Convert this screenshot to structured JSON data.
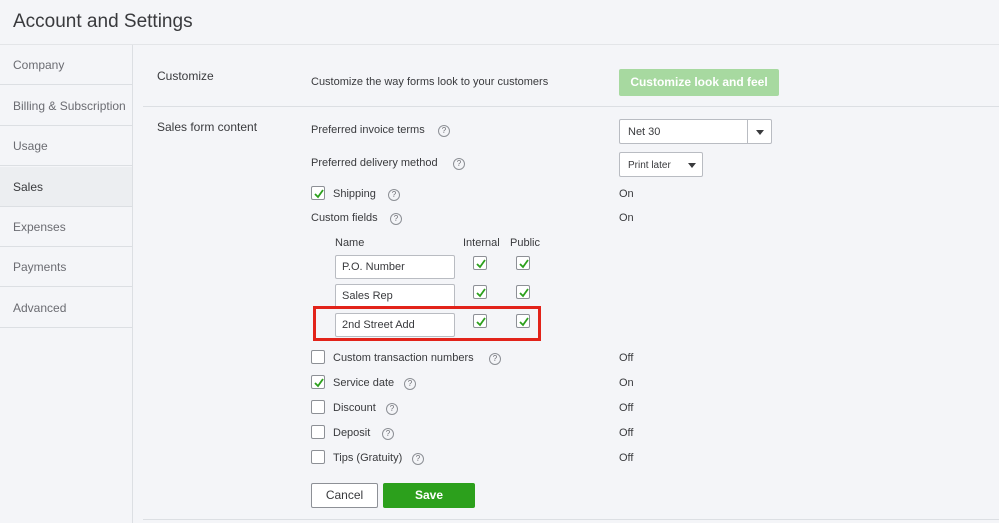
{
  "header": {
    "title": "Account and Settings"
  },
  "sidebar": {
    "items": [
      {
        "label": "Company"
      },
      {
        "label": "Billing & Subscription"
      },
      {
        "label": "Usage"
      },
      {
        "label": "Sales",
        "active": true
      },
      {
        "label": "Expenses"
      },
      {
        "label": "Payments"
      },
      {
        "label": "Advanced"
      }
    ]
  },
  "customize": {
    "section_label": "Customize",
    "description": "Customize the way forms look to your customers",
    "button_label": "Customize look and feel"
  },
  "sales_form": {
    "section_label": "Sales form content",
    "invoice_terms": {
      "label": "Preferred invoice terms",
      "value": "Net 30"
    },
    "delivery_method": {
      "label": "Preferred delivery method",
      "value": "Print later"
    },
    "shipping": {
      "label": "Shipping",
      "checked": true,
      "status": "On"
    },
    "custom_fields": {
      "label": "Custom fields",
      "status": "On",
      "headers": {
        "name": "Name",
        "internal": "Internal",
        "public": "Public"
      },
      "rows": [
        {
          "name": "P.O. Number",
          "internal": true,
          "public": true
        },
        {
          "name": "Sales Rep",
          "internal": true,
          "public": true
        },
        {
          "name": "2nd Street Add",
          "internal": true,
          "public": true
        }
      ]
    },
    "custom_transaction_numbers": {
      "label": "Custom transaction numbers",
      "checked": false,
      "status": "Off"
    },
    "service_date": {
      "label": "Service date",
      "checked": true,
      "status": "On"
    },
    "discount": {
      "label": "Discount",
      "checked": false,
      "status": "Off"
    },
    "deposit": {
      "label": "Deposit",
      "checked": false,
      "status": "Off"
    },
    "tips": {
      "label": "Tips (Gratuity)",
      "checked": false,
      "status": "Off"
    }
  },
  "actions": {
    "cancel_label": "Cancel",
    "save_label": "Save"
  },
  "colors": {
    "accent_green": "#2ca01c",
    "disabled_green": "#a7d9a0",
    "highlight_red": "#e2231a",
    "check_green": "#2ca01c"
  }
}
